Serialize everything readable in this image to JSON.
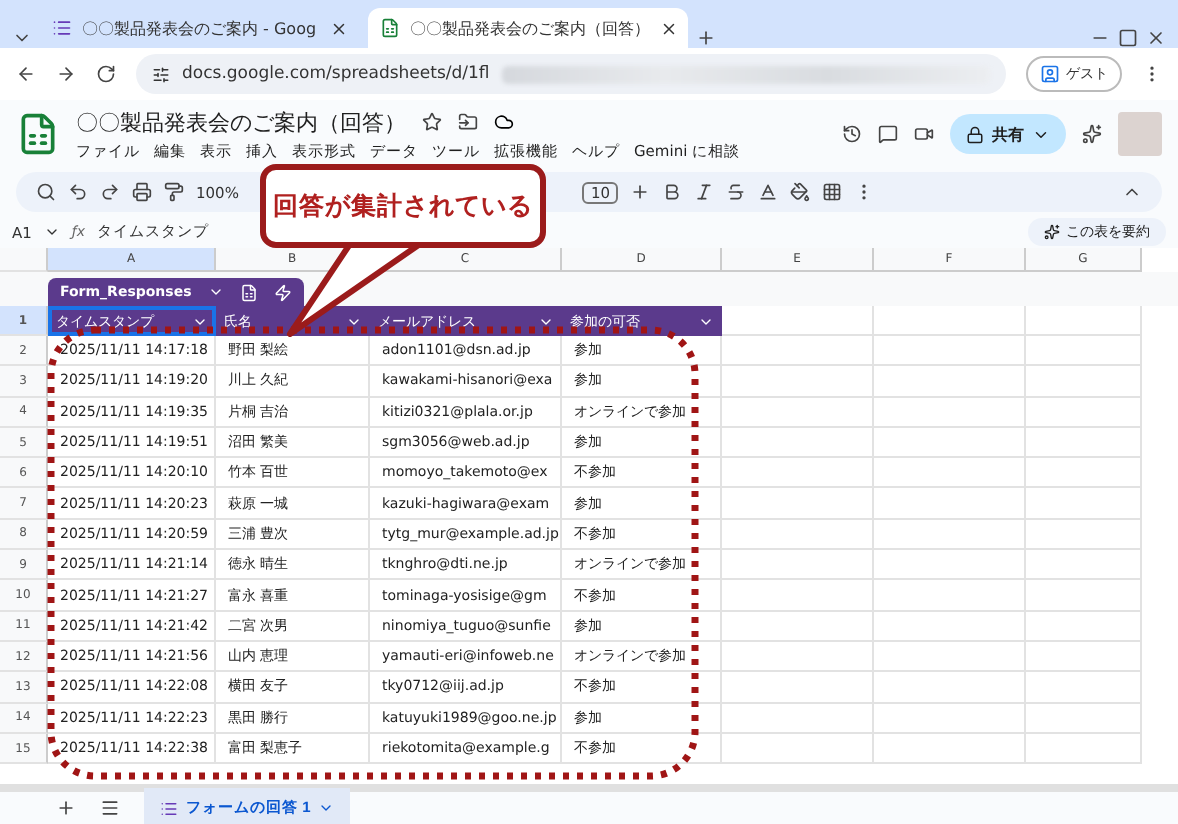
{
  "browser": {
    "tabs": [
      {
        "title": "〇〇製品発表会のご案内 - Goog",
        "selected": false,
        "kind": "forms"
      },
      {
        "title": "〇〇製品発表会のご案内（回答）",
        "selected": true,
        "kind": "sheets"
      }
    ],
    "url": "docs.google.com/spreadsheets/d/1fl",
    "profile": "ゲスト"
  },
  "doc": {
    "title": "〇〇製品発表会のご案内（回答）",
    "menus": [
      "ファイル",
      "編集",
      "表示",
      "挿入",
      "表示形式",
      "データ",
      "ツール",
      "拡張機能",
      "ヘルプ",
      "Gemini に相談"
    ],
    "share": "共有",
    "zoom": "100%",
    "font_size": "10",
    "cell_ref": "A1",
    "fx": "ƒx",
    "formula": "タイムスタンプ",
    "summarize": "この表を要約"
  },
  "sheet": {
    "columns": [
      {
        "label": "A",
        "selected": true
      },
      {
        "label": "B",
        "selected": false
      },
      {
        "label": "C",
        "selected": false
      },
      {
        "label": "D",
        "selected": false
      },
      {
        "label": "E",
        "selected": false
      },
      {
        "label": "F",
        "selected": false
      },
      {
        "label": "G",
        "selected": false
      }
    ],
    "table_name": "Form_Responses",
    "header_row": "1",
    "headers": [
      "タイムスタンプ",
      "氏名",
      "メールアドレス",
      "参加の可否"
    ],
    "rows": [
      {
        "num": "2",
        "cells": [
          "2025/11/11 14:17:18",
          "野田 梨絵",
          "adon1101@dsn.ad.jp",
          "参加"
        ]
      },
      {
        "num": "3",
        "cells": [
          "2025/11/11 14:19:20",
          "川上 久紀",
          "kawakami-hisanori@exa",
          "参加"
        ]
      },
      {
        "num": "4",
        "cells": [
          "2025/11/11 14:19:35",
          "片桐 吉治",
          "kitizi0321@plala.or.jp",
          "オンラインで参加"
        ]
      },
      {
        "num": "5",
        "cells": [
          "2025/11/11 14:19:51",
          "沼田 繁美",
          "sgm3056@web.ad.jp",
          "参加"
        ]
      },
      {
        "num": "6",
        "cells": [
          "2025/11/11 14:20:10",
          "竹本 百世",
          "momoyo_takemoto@ex",
          "不参加"
        ]
      },
      {
        "num": "7",
        "cells": [
          "2025/11/11 14:20:23",
          "萩原 一城",
          "kazuki-hagiwara@exam",
          "参加"
        ]
      },
      {
        "num": "8",
        "cells": [
          "2025/11/11 14:20:59",
          "三浦 豊次",
          "tytg_mur@example.ad.jp",
          "不参加"
        ]
      },
      {
        "num": "9",
        "cells": [
          "2025/11/11 14:21:14",
          "徳永 晴生",
          "tknghro@dti.ne.jp",
          "オンラインで参加"
        ]
      },
      {
        "num": "10",
        "cells": [
          "2025/11/11 14:21:27",
          "富永 喜重",
          "tominaga-yosisige@gm",
          "不参加"
        ]
      },
      {
        "num": "11",
        "cells": [
          "2025/11/11 14:21:42",
          "二宮 次男",
          "ninomiya_tuguo@sunfie",
          "参加"
        ]
      },
      {
        "num": "12",
        "cells": [
          "2025/11/11 14:21:56",
          "山内 恵理",
          "yamauti-eri@infoweb.ne",
          "オンラインで参加"
        ]
      },
      {
        "num": "13",
        "cells": [
          "2025/11/11 14:22:08",
          "横田 友子",
          "tky0712@iij.ad.jp",
          "不参加"
        ]
      },
      {
        "num": "14",
        "cells": [
          "2025/11/11 14:22:23",
          "黒田 勝行",
          "katuyuki1989@goo.ne.jp",
          "参加"
        ]
      },
      {
        "num": "15",
        "cells": [
          "2025/11/11 14:22:38",
          "富田 梨恵子",
          "riekotomita@example.g",
          "不参加"
        ]
      }
    ],
    "sheet_tab": "フォームの回答 1"
  },
  "callout": {
    "text": "回答が集計されている"
  }
}
